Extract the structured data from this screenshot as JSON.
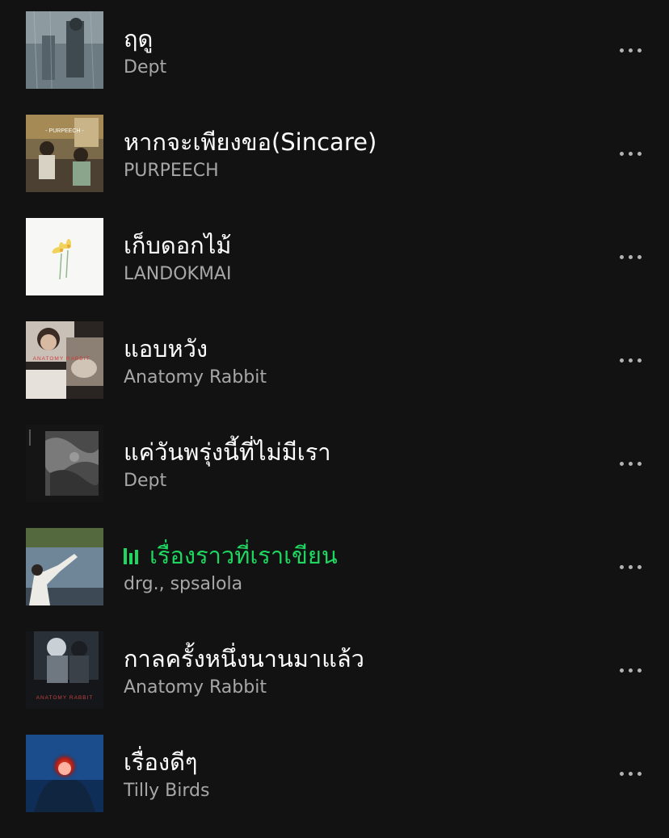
{
  "accent_color": "#1ed760",
  "tracks": [
    {
      "title": "ฤดู",
      "artist": "Dept",
      "cover": "rainy-window-cover",
      "playing": false
    },
    {
      "title": "หากจะเพียงขอ(Sincare)",
      "artist": "PURPEECH",
      "cover": "purpeech-cover",
      "cover_text": "- PURPEECH -",
      "playing": false
    },
    {
      "title": "เก็บดอกไม้",
      "artist": "LANDOKMAI",
      "cover": "flower-cover",
      "playing": false
    },
    {
      "title": "แอบหวัง",
      "artist": "Anatomy Rabbit",
      "cover": "anatomy-rabbit-cover",
      "cover_text": "ANATOMY RABBIT",
      "playing": false
    },
    {
      "title": "แค่วันพรุ่งนี้ที่ไม่มีเรา",
      "artist": "Dept",
      "cover": "grey-texture-cover",
      "playing": false
    },
    {
      "title": "เรื่องราวที่เราเขียน",
      "artist": "drg., spsalola",
      "cover": "lake-cover",
      "playing": true
    },
    {
      "title": "กาลครั้งหนึ่งนานมาแล้ว",
      "artist": "Anatomy Rabbit",
      "cover": "anatomy-rabbit-dark-cover",
      "cover_text": "ANATOMY RABBIT",
      "playing": false
    },
    {
      "title": "เรื่องดีๆ",
      "artist": "Tilly Birds",
      "cover": "red-light-cover",
      "playing": false
    }
  ]
}
